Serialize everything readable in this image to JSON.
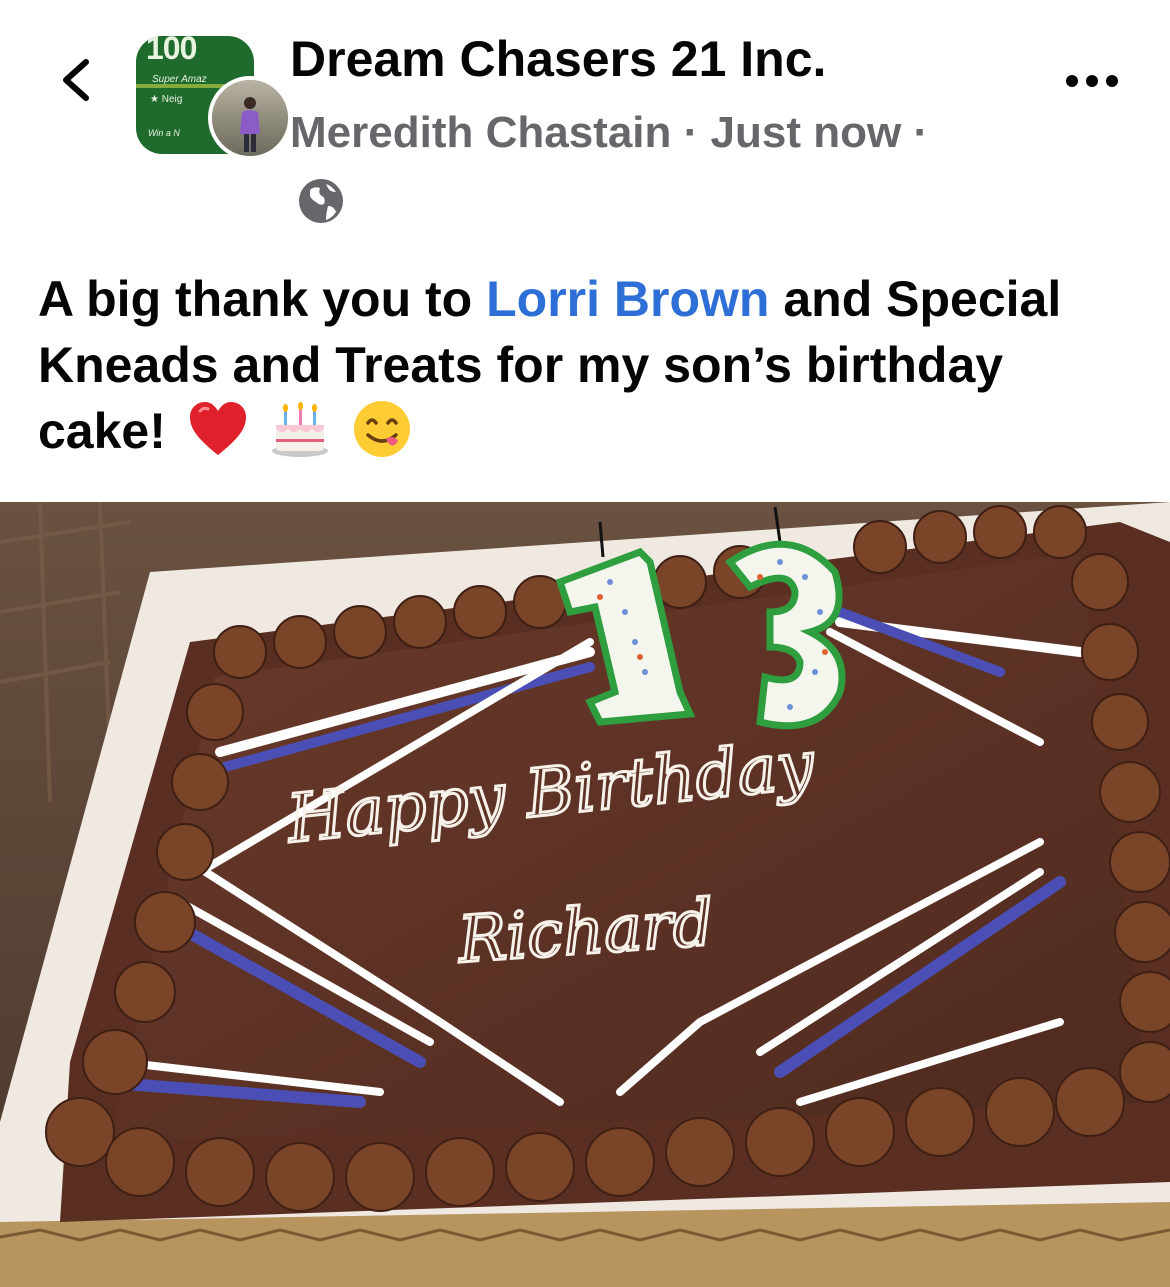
{
  "header": {
    "group_name": "Dream Chasers 21 Inc.",
    "author": "Meredith Chastain",
    "separator": "·",
    "time": "Just now",
    "visibility_icon": "globe-icon",
    "back_icon": "chevron-left-icon",
    "more_icon": "more-horizontal-icon"
  },
  "group_avatar": {
    "number": "100",
    "line1": "Super Amaz",
    "line2": "★ Neig",
    "line3": "Win a N"
  },
  "post": {
    "text_before": "A big thank you to ",
    "mention": "Lorri Brown",
    "text_after": " and Special Kneads and Treats for my son’s birthday cake!",
    "emojis": [
      "red-heart-emoji",
      "birthday-cake-emoji",
      "face-savoring-food-emoji"
    ]
  },
  "photo": {
    "candle_number": "13",
    "cake_line1": "Happy Birthday",
    "cake_line2": "Richard"
  },
  "colors": {
    "mention": "#2d6fd6",
    "meta_text": "#65676b",
    "frosting": "#6b3b22",
    "cake_top": "#5e3325",
    "candle_green": "#35a845",
    "stripe_blue": "#4b4fb5"
  }
}
